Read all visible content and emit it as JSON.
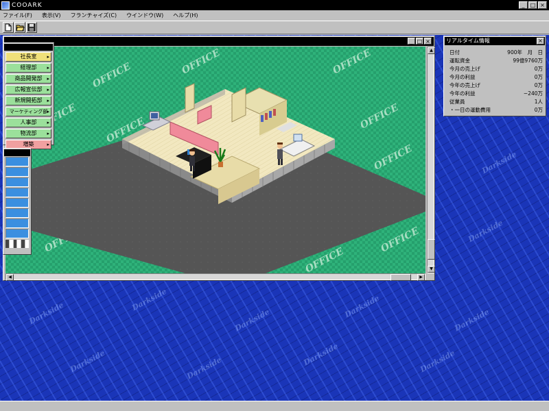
{
  "app": {
    "title": "COOARK",
    "window_buttons": [
      "_",
      "□",
      "×"
    ]
  },
  "menubar": {
    "items": [
      "ファイル(F)",
      "表示(V)",
      "フランチャイズ(C)",
      "ウインドウ(W)",
      "ヘルプ(H)"
    ]
  },
  "toolbar": {
    "buttons": [
      "new-file-icon",
      "open-folder-icon",
      "save-disk-icon"
    ]
  },
  "office_window": {
    "buttons": [
      "_",
      "□",
      "×"
    ],
    "watermark": "OFFICE",
    "scroll_arrows": {
      "up": "▲",
      "down": "▼",
      "left": "◀",
      "right": "▶"
    }
  },
  "departments": {
    "items": [
      {
        "label": "社長室",
        "color": "#f0e07a"
      },
      {
        "label": "経理部",
        "color": "#9be09b"
      },
      {
        "label": "商品開発部",
        "color": "#9be09b"
      },
      {
        "label": "広報宣伝部",
        "color": "#9be09b"
      },
      {
        "label": "新規開拓部",
        "color": "#9be09b"
      },
      {
        "label": "マーケティング部",
        "color": "#9be09b"
      },
      {
        "label": "人事部",
        "color": "#9be09b"
      },
      {
        "label": "物流部",
        "color": "#9be09b"
      },
      {
        "label": "増築",
        "color": "#f0a0a0"
      }
    ],
    "arrow": "▸"
  },
  "realtime_info": {
    "title": "リアルタイム情報",
    "close": "×",
    "rows": [
      {
        "label": "日付",
        "value": "900年　月　日"
      },
      {
        "label": "運転資金",
        "value": "99億9760万"
      },
      {
        "label": "今月の売上げ",
        "value": "0万"
      },
      {
        "label": "今月の利益",
        "value": "0万"
      },
      {
        "label": "今年の売上げ",
        "value": "0万"
      },
      {
        "label": "今年の利益",
        "value": "−240万"
      },
      {
        "label": "従業員",
        "value": "1人"
      },
      {
        "label": "・一日の運動費用",
        "value": "0万"
      }
    ]
  },
  "desktop": {
    "tile_text": "Darkside"
  },
  "colors": {
    "desktop_blue": "#1a35b8",
    "carpet_green": "#25a06d",
    "floor_dark": "#555555",
    "office_floor": "#f2e8c0"
  }
}
